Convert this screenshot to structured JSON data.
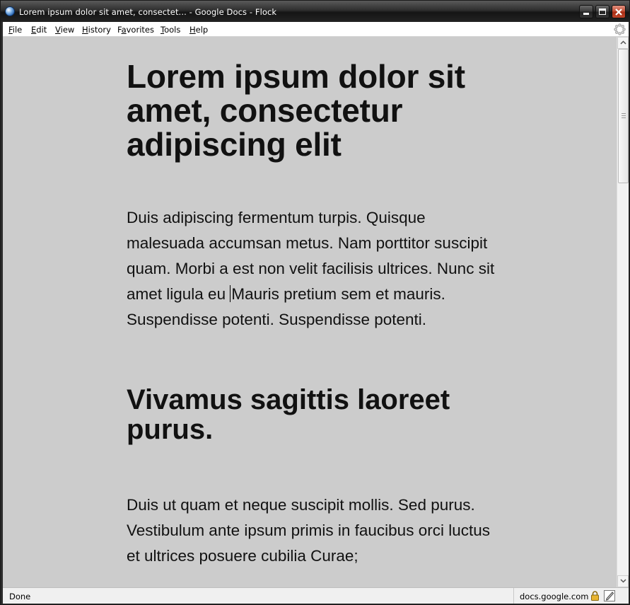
{
  "window": {
    "title": "Lorem ipsum dolor sit amet, consectet... - Google Docs - Flock"
  },
  "menu": {
    "items": [
      {
        "label": "File",
        "underline": "F",
        "rest": "ile"
      },
      {
        "label": "Edit",
        "underline": "E",
        "rest": "dit"
      },
      {
        "label": "View",
        "underline": "V",
        "rest": "iew"
      },
      {
        "label": "History",
        "underline": "H",
        "rest": "istory"
      },
      {
        "label": "Favorites",
        "underline": "a",
        "rest": "vorites",
        "prefix": "F"
      },
      {
        "label": "Tools",
        "underline": "T",
        "rest": "ools"
      },
      {
        "label": "Help",
        "underline": "H",
        "rest": "elp"
      }
    ]
  },
  "document": {
    "heading1": "Lorem ipsum dolor sit amet, consectetur adipiscing elit",
    "paragraph1_before_caret": "Duis adipiscing fermentum turpis. Quisque malesuada accumsan metus. Nam porttitor suscipit quam. Morbi a est non velit facilisis ultrices. Nunc sit amet ligula eu ",
    "paragraph1_after_caret": "Mauris pretium sem et mauris. Suspendisse potenti. Suspendisse potenti.",
    "heading2": "Vivamus sagittis laoreet purus.",
    "paragraph2": "Duis ut quam et neque suscipit mollis. Sed purus. Vestibulum ante ipsum primis in faucibus orci luctus et ultrices posuere cubilia Curae;"
  },
  "status": {
    "text": "Done",
    "host": "docs.google.com"
  },
  "icons": {
    "app": "flock-globe-icon",
    "throbber": "throbber-icon",
    "lock": "lock-icon",
    "edit": "edit-page-icon"
  },
  "colors": {
    "content_background": "#cccccc",
    "titlebar": "#2e2e2e"
  }
}
